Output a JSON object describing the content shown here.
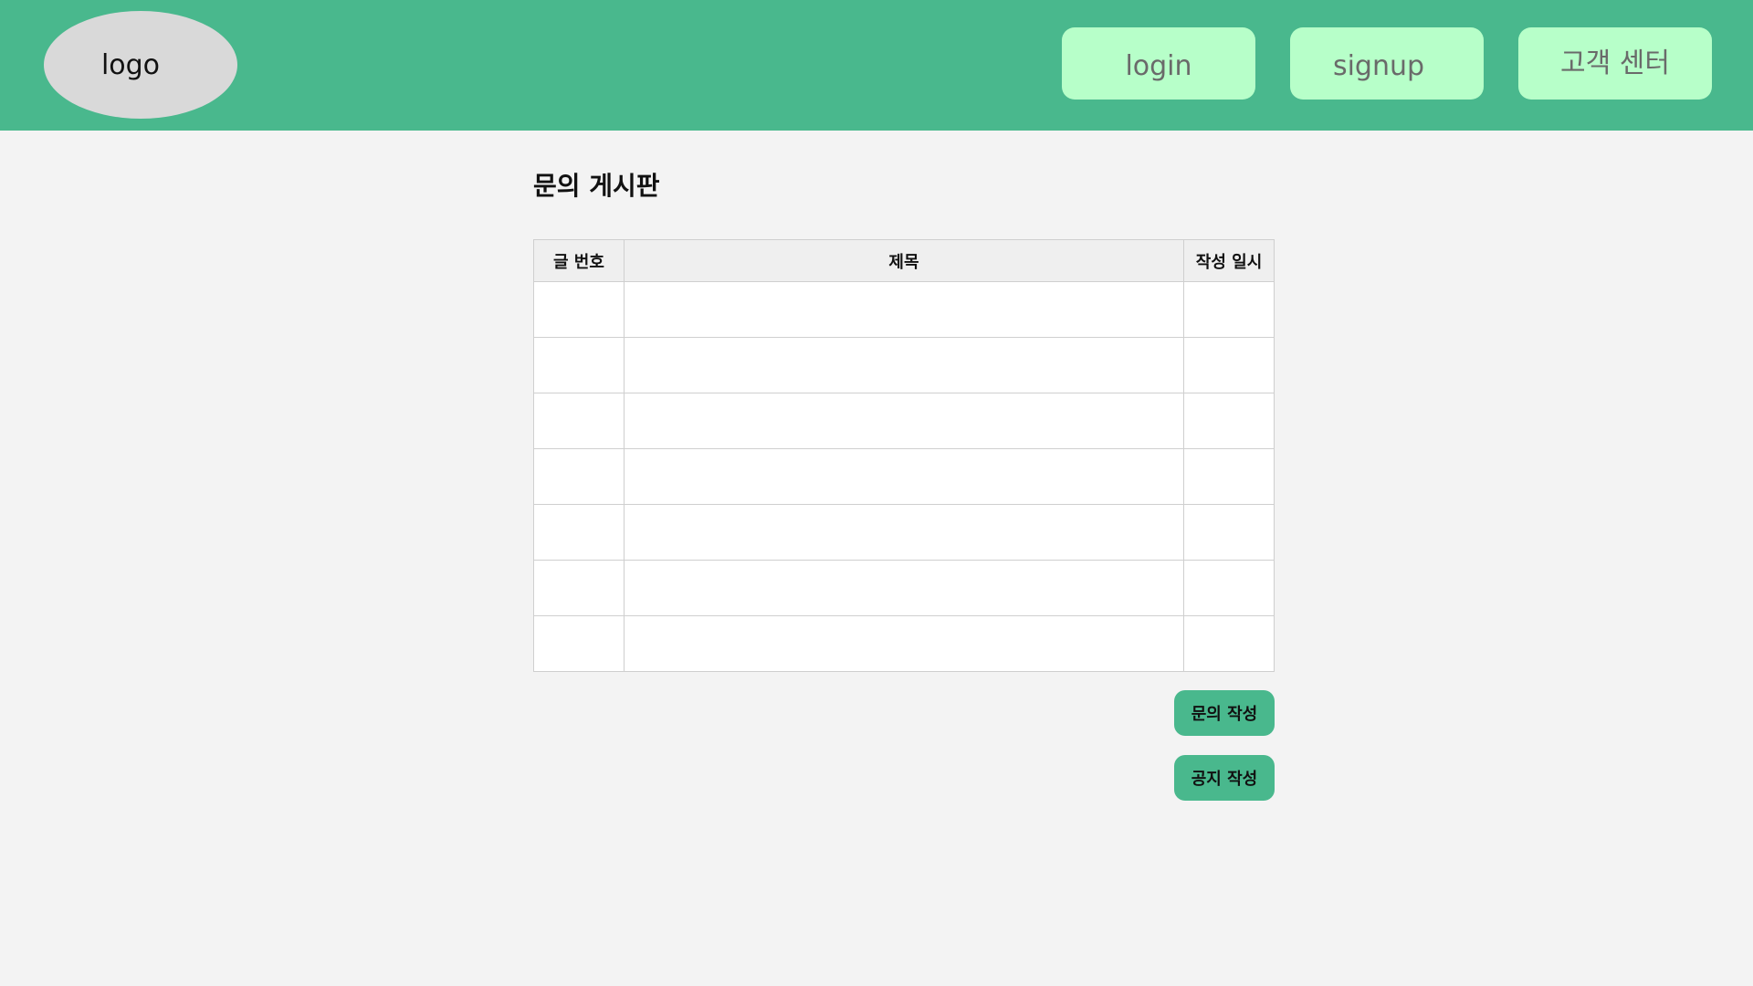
{
  "header": {
    "logo_text": "logo",
    "nav": {
      "login": "login",
      "signup": "signup",
      "customer_center": "고객 센터"
    },
    "colors": {
      "header_bg": "#49b88d",
      "nav_button_bg": "#b7ffc9",
      "logo_bg": "#d9d9d9"
    }
  },
  "main": {
    "title": "문의 게시판",
    "table": {
      "columns": [
        "글 번호",
        "제목",
        "작성 일시"
      ],
      "rows": [
        [
          "",
          "",
          ""
        ],
        [
          "",
          "",
          ""
        ],
        [
          "",
          "",
          ""
        ],
        [
          "",
          "",
          ""
        ],
        [
          "",
          "",
          ""
        ],
        [
          "",
          "",
          ""
        ],
        [
          "",
          "",
          ""
        ]
      ]
    },
    "buttons": {
      "write_inquiry": "문의 작성",
      "write_notice": "공지 작성"
    }
  }
}
